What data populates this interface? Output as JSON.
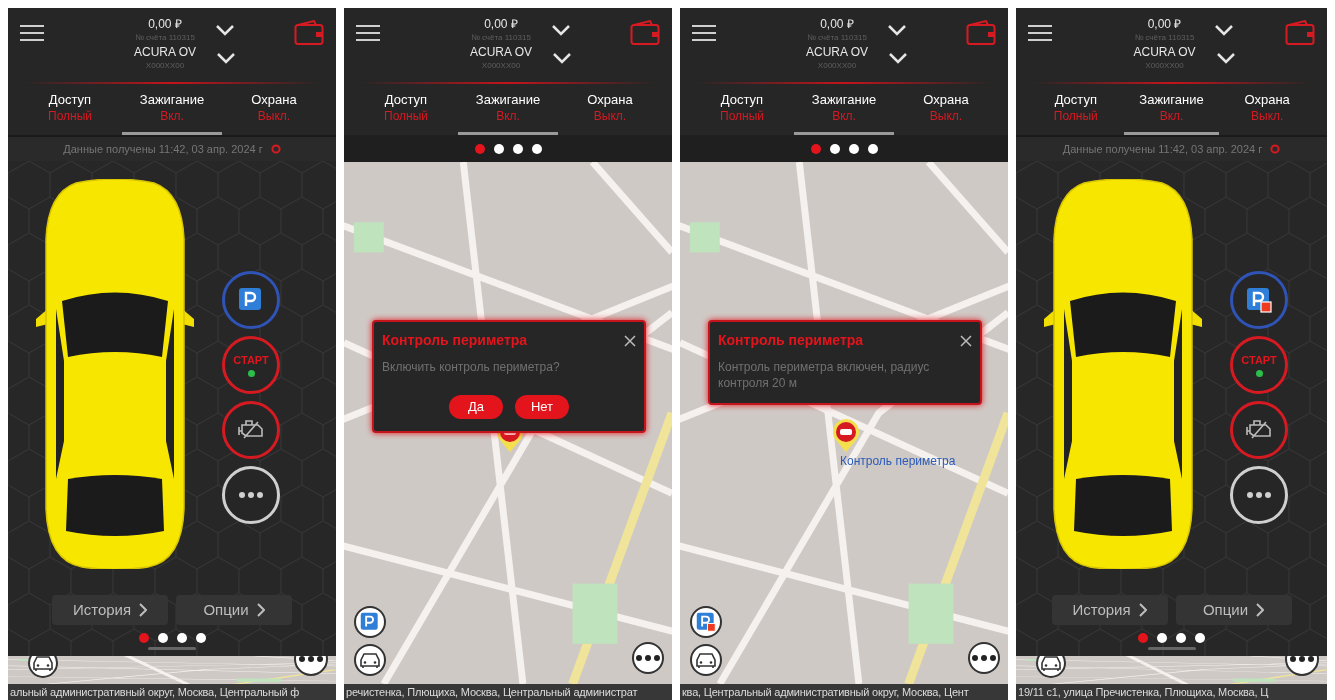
{
  "screens": [
    {
      "kind": "car",
      "header": {
        "balance": "0,00 ₽",
        "account": "№ счёта 110315",
        "car_name": "ACURA OV",
        "plate": "X000XX00"
      },
      "tabs": [
        {
          "label": "Доступ",
          "value": "Полный",
          "selected": false
        },
        {
          "label": "Зажигание",
          "value": "Вкл.",
          "selected": true
        },
        {
          "label": "Охрана",
          "value": "Выкл.",
          "selected": false
        }
      ],
      "timestamp": "Данные получены 11:42, 03 апр. 2024 г",
      "parking_badge": false,
      "start_label": "СТАРТ",
      "buttons": [
        "История",
        "Опции"
      ],
      "dots": [
        {
          "selected": true
        },
        {
          "selected": false
        },
        {
          "selected": false
        },
        {
          "selected": false
        }
      ],
      "address": "альный административный округ, Москва, Центральный ф"
    },
    {
      "kind": "map",
      "header": {
        "balance": "0,00 ₽",
        "account": "№ счёта 110315",
        "car_name": "ACURA OV",
        "plate": "X000XX00"
      },
      "tabs": [
        {
          "label": "Доступ",
          "value": "Полный",
          "selected": false
        },
        {
          "label": "Зажигание",
          "value": "Вкл.",
          "selected": true
        },
        {
          "label": "Охрана",
          "value": "Выкл.",
          "selected": false
        }
      ],
      "dots": [
        {
          "selected": true
        },
        {
          "selected": false
        },
        {
          "selected": false
        },
        {
          "selected": false
        }
      ],
      "dialog": {
        "title": "Контроль периметра",
        "message": "Включить контроль периметра?",
        "buttons": [
          "Да",
          "Нет"
        ]
      },
      "parking_badge": false,
      "address": "речистенка, Плющиха, Москва, Центральный администрат"
    },
    {
      "kind": "map",
      "header": {
        "balance": "0,00 ₽",
        "account": "№ счёта 110315",
        "car_name": "ACURA OV",
        "plate": "X000XX00"
      },
      "tabs": [
        {
          "label": "Доступ",
          "value": "Полный",
          "selected": false
        },
        {
          "label": "Зажигание",
          "value": "Вкл.",
          "selected": true
        },
        {
          "label": "Охрана",
          "value": "Выкл.",
          "selected": false
        }
      ],
      "dots": [
        {
          "selected": true
        },
        {
          "selected": false
        },
        {
          "selected": false
        },
        {
          "selected": false
        }
      ],
      "dialog": {
        "title": "Контроль периметра",
        "message": "Контроль периметра включен, радиус контроля 20 м"
      },
      "marker_label": "Контроль периметра",
      "parking_badge": true,
      "address": "ква, Центральный административный округ, Москва, Цент"
    },
    {
      "kind": "car",
      "header": {
        "balance": "0,00 ₽",
        "account": "№ счёта 110315",
        "car_name": "ACURA OV",
        "plate": "X000XX00"
      },
      "tabs": [
        {
          "label": "Доступ",
          "value": "Полный",
          "selected": false
        },
        {
          "label": "Зажигание",
          "value": "Вкл.",
          "selected": true
        },
        {
          "label": "Охрана",
          "value": "Выкл.",
          "selected": false
        }
      ],
      "timestamp": "Данные получены 11:42, 03 апр. 2024 г",
      "parking_badge": true,
      "start_label": "СТАРТ",
      "buttons": [
        "История",
        "Опции"
      ],
      "dots": [
        {
          "selected": true
        },
        {
          "selected": false
        },
        {
          "selected": false
        },
        {
          "selected": false
        }
      ],
      "address": "19/11 с1, улица Пречистенка, Плющиха, Москва, Ц"
    }
  ]
}
